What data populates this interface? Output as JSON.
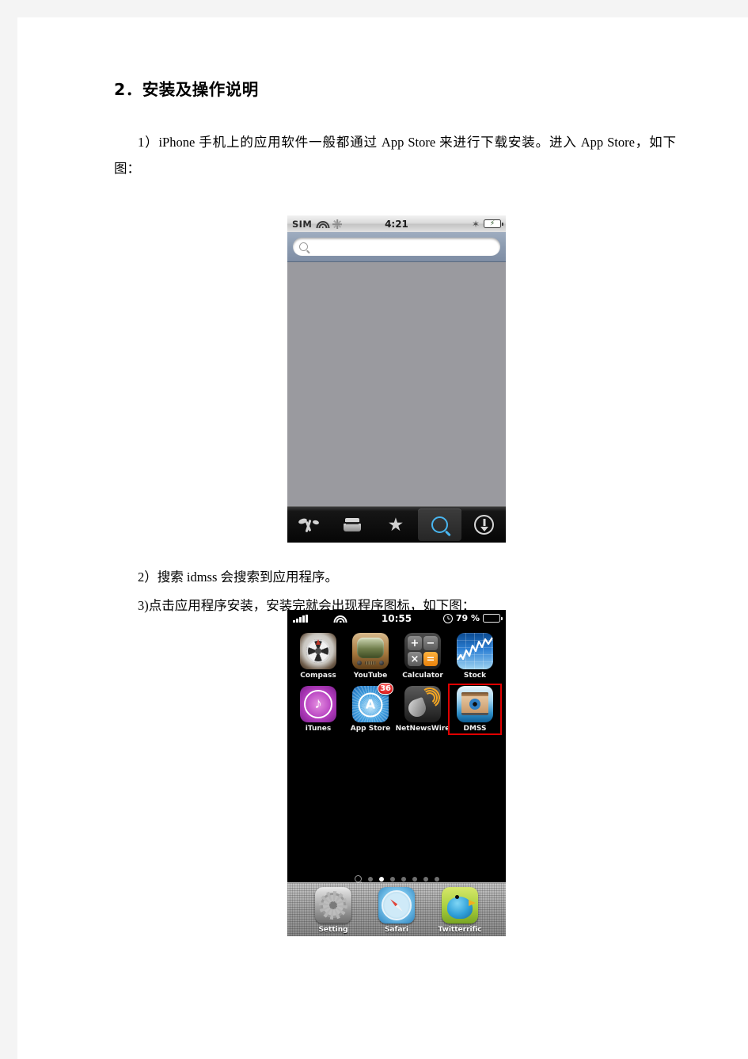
{
  "document": {
    "heading": "2．安装及操作说明",
    "paragraphs": [
      {
        "index": "1）",
        "text": "iPhone 手机上的应用软件一般都通过 App Store 来进行下载安装。进入 App Store，如下图："
      },
      {
        "index": "2）",
        "text": "搜索 idmss 会搜索到应用程序。"
      },
      {
        "index": "3)",
        "text": "点击应用程序安装，安装完就会出现程序图标，如下图："
      }
    ]
  },
  "screenshot_appstore": {
    "status_bar": {
      "carrier": "SIM",
      "wifi_icon": "wifi-icon",
      "activity_icon": "spinner-icon",
      "time": "4:21",
      "bluetooth_icon": "bluetooth-icon",
      "battery_icon": "battery-charging-icon"
    },
    "search": {
      "icon": "search-icon",
      "value": "",
      "placeholder": ""
    },
    "tabs": [
      {
        "id": "featured",
        "icon": "featured-icon",
        "selected": false
      },
      {
        "id": "categories",
        "icon": "categories-icon",
        "selected": false
      },
      {
        "id": "top25",
        "icon": "star-icon",
        "selected": false
      },
      {
        "id": "search",
        "icon": "search-icon",
        "selected": true
      },
      {
        "id": "updates",
        "icon": "download-arrow-icon",
        "selected": false
      }
    ],
    "accent_color": "#49b6f0",
    "content_background": "#9a9a9f"
  },
  "screenshot_home": {
    "status_bar": {
      "signal_icon": "signal-bars-icon",
      "wifi_icon": "wifi-icon",
      "time": "10:55",
      "alarm_icon": "alarm-clock-icon",
      "battery_percent": "79 %",
      "battery_icon": "battery-icon"
    },
    "rows": [
      [
        {
          "label": "Compass",
          "icon": "compass-app-icon",
          "badge": null,
          "highlight": false
        },
        {
          "label": "YouTube",
          "icon": "youtube-app-icon",
          "badge": null,
          "highlight": false
        },
        {
          "label": "Calculator",
          "icon": "calculator-app-icon",
          "badge": null,
          "highlight": false
        },
        {
          "label": "Stock",
          "icon": "stock-app-icon",
          "badge": null,
          "highlight": false
        }
      ],
      [
        {
          "label": "iTunes",
          "icon": "itunes-app-icon",
          "badge": null,
          "highlight": false
        },
        {
          "label": "App Store",
          "icon": "appstore-app-icon",
          "badge": "36",
          "highlight": false
        },
        {
          "label": "NetNewsWire",
          "icon": "netnewswire-app-icon",
          "badge": null,
          "highlight": false
        },
        {
          "label": "DMSS",
          "icon": "dmss-app-icon",
          "badge": null,
          "highlight": true
        }
      ]
    ],
    "calculator_keys": [
      "+",
      "−",
      "×",
      "="
    ],
    "page_dots": {
      "count": 7,
      "active_index": 1,
      "spotlight_icon": "search-icon"
    },
    "dock": [
      {
        "label": "Setting",
        "icon": "settings-app-icon"
      },
      {
        "label": "Safari",
        "icon": "safari-app-icon"
      },
      {
        "label": "Twitterrific",
        "icon": "twitterrific-app-icon"
      }
    ],
    "highlight_color": "#e00000",
    "badge_color": "#cc0000"
  }
}
